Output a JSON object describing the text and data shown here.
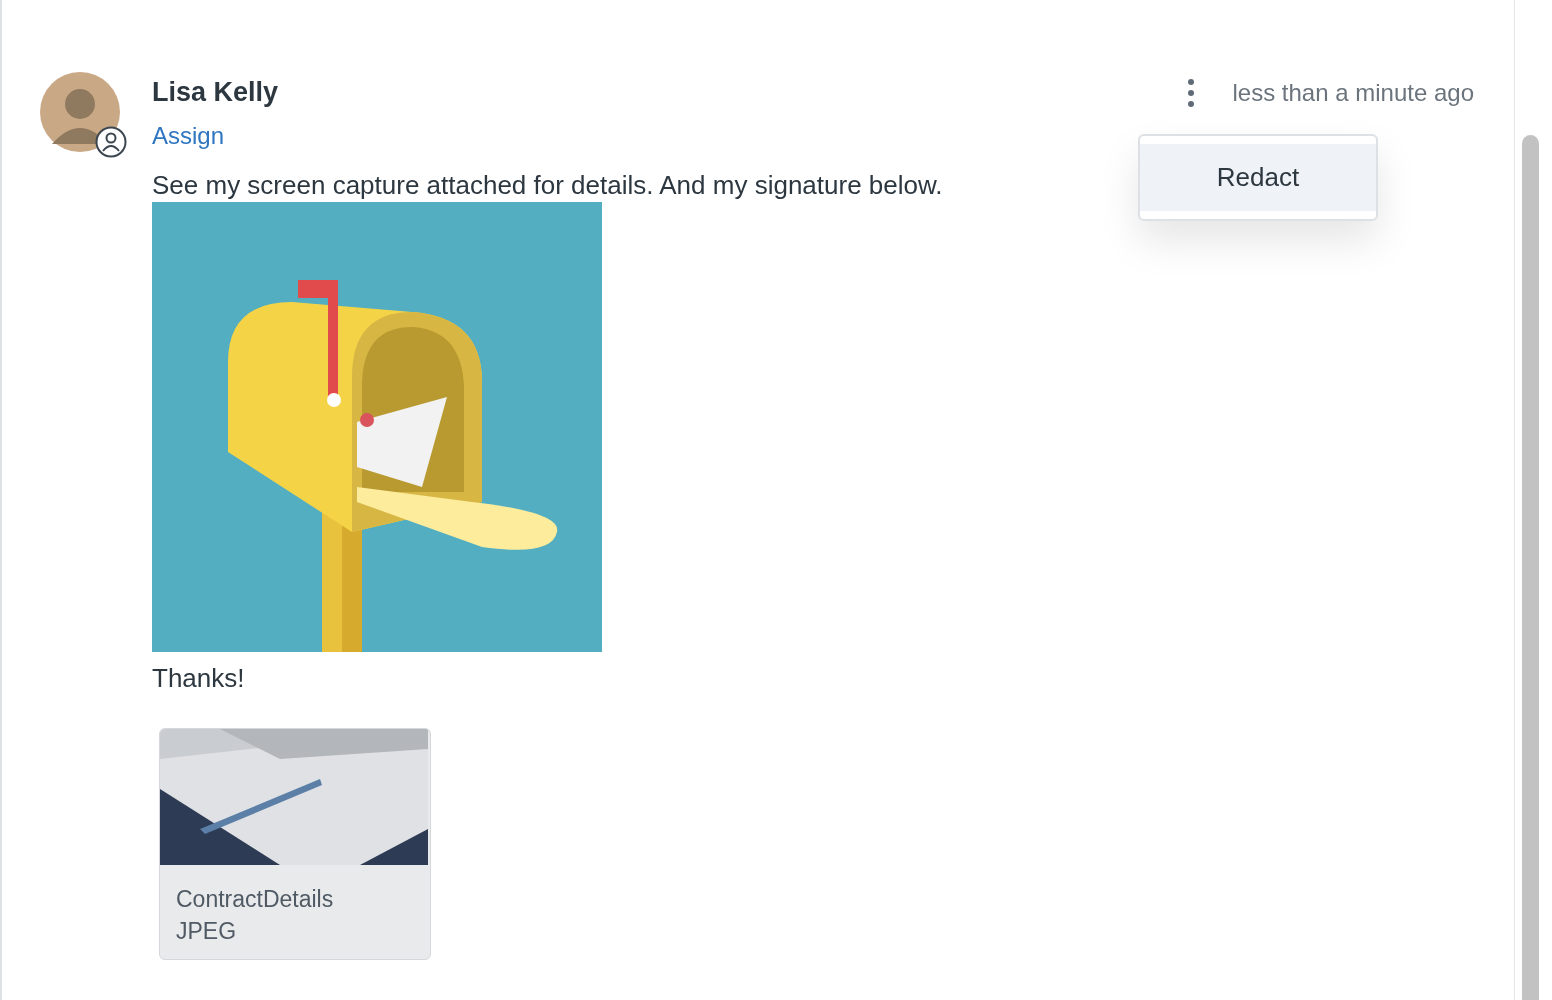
{
  "comment": {
    "author": "Lisa Kelly",
    "action_link": "Assign",
    "time": "less than a minute ago",
    "body": "See my screen capture attached for details. And my signature below.",
    "closing": "Thanks!",
    "attachment": {
      "name": "ContractDetails",
      "type": "JPEG"
    }
  },
  "menu": {
    "items": [
      {
        "label": "Redact",
        "selected": true
      }
    ]
  }
}
